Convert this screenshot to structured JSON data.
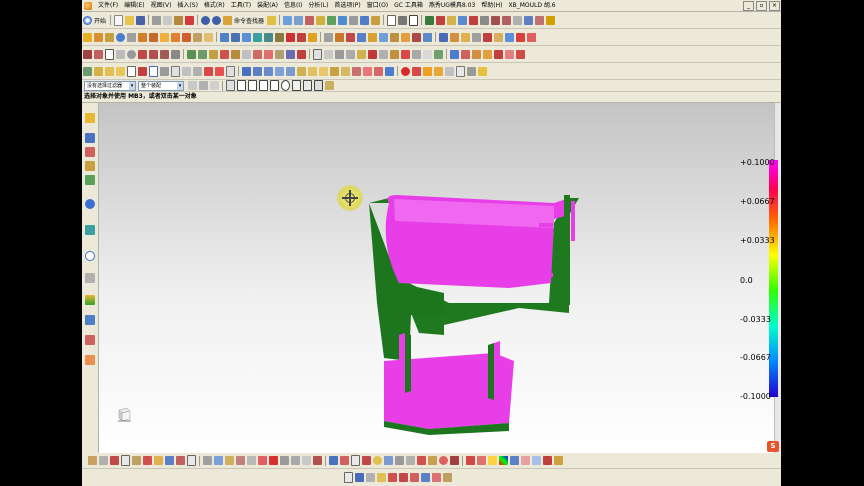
{
  "menu": {
    "items": [
      "文件(F)",
      "编辑(E)",
      "视图(V)",
      "插入(S)",
      "格式(R)",
      "工具(T)",
      "装配(A)",
      "信息(I)",
      "分析(L)",
      "首选项(P)",
      "窗口(O)",
      "GC 工具箱",
      "燕秀UG模具8.03",
      "帮助(H)",
      "XB_MOULD 胡.6"
    ]
  },
  "toolbar1": {
    "start_label": "开始",
    "command_finder_label": "命令查找器"
  },
  "selection": {
    "filter_value": "没有选择过滤器",
    "assembly_value": "整个装配"
  },
  "cue_line": "选择对象并使用 MB3，或者双击某一对象",
  "legend": {
    "labels": [
      "+0.1000",
      "+0.0667",
      "+0.0333",
      "0.0",
      "-0.0333",
      "-0.0667",
      "-0.1000"
    ]
  },
  "colors": {
    "model_magenta": "#e83ee8",
    "model_green": "#1f7a1f",
    "accent": "#ff00ff"
  },
  "watermark": "S"
}
